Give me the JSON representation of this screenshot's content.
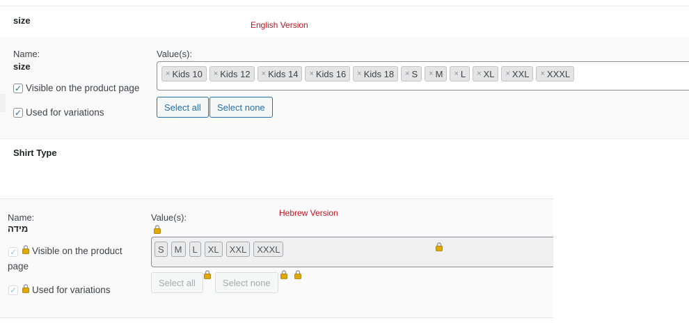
{
  "english": {
    "version_label": "English Version",
    "attribute_title": "size",
    "name_label": "Name:",
    "name_value": "size",
    "values_label": "Value(s):",
    "visible_label": "Visible on the product page",
    "variations_label": "Used for variations",
    "visible_checked": true,
    "variations_checked": true,
    "remove_glyph": "×",
    "tags": [
      "Kids 10",
      "Kids 12",
      "Kids 14",
      "Kids 16",
      "Kids 18",
      "S",
      "M",
      "L",
      "XL",
      "XXL",
      "XXXL"
    ],
    "select_all": "Select all",
    "select_none": "Select none",
    "next_attribute_title": "Shirt Type"
  },
  "hebrew": {
    "version_label": "Hebrew Version",
    "name_label": "Name:",
    "name_value": "מידה",
    "values_label": "Value(s):",
    "visible_label_line1": "Visible on the product",
    "visible_label_line2": "page",
    "variations_label": "Used for variations",
    "visible_checked": true,
    "variations_checked": true,
    "tags": [
      "S",
      "M",
      "L",
      "XL",
      "XXL",
      "XXXL"
    ],
    "select_all": "Select all",
    "select_none": "Select none"
  },
  "colors": {
    "version_label": "#c2121f",
    "accent": "#2271b1",
    "lock_body": "#e0a800",
    "lock_shackle": "#9a9a9a"
  },
  "icons": {
    "checkbox": "checkmark-icon",
    "lock": "padlock-icon",
    "remove": "remove-x-icon"
  }
}
